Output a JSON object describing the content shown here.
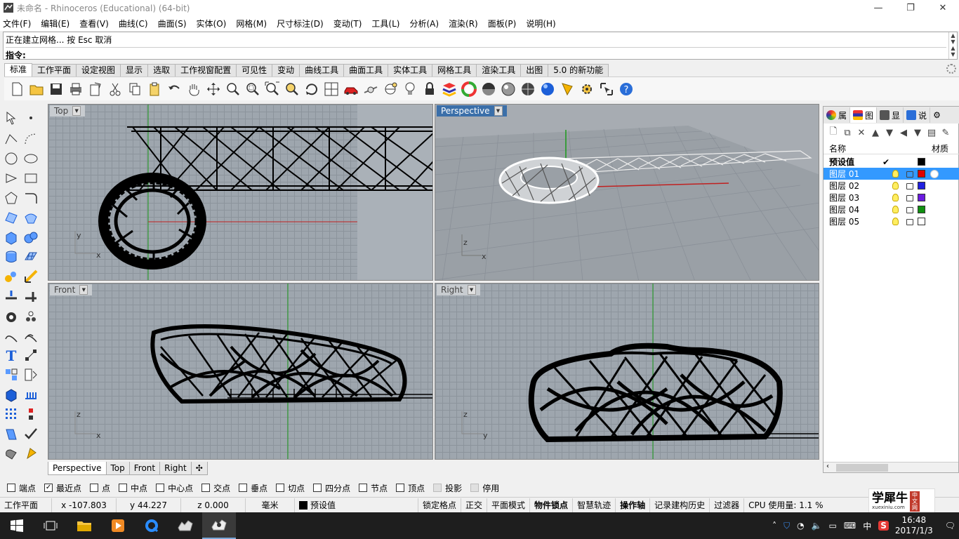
{
  "window": {
    "title": "未命名 - Rhinoceros (Educational) (64-bit)"
  },
  "menu": [
    "文件(F)",
    "编辑(E)",
    "查看(V)",
    "曲线(C)",
    "曲面(S)",
    "实体(O)",
    "网格(M)",
    "尺寸标注(D)",
    "变动(T)",
    "工具(L)",
    "分析(A)",
    "渲染(R)",
    "面板(P)",
    "说明(H)"
  ],
  "command": {
    "history": "正在建立网格... 按 Esc 取消",
    "prompt": "指令:"
  },
  "toolbar_tabs": [
    "标准",
    "工作平面",
    "设定视图",
    "显示",
    "选取",
    "工作视窗配置",
    "可见性",
    "变动",
    "曲线工具",
    "曲面工具",
    "实体工具",
    "网格工具",
    "渲染工具",
    "出图",
    "5.0 的新功能"
  ],
  "toolbar_icons": [
    "new-icon",
    "open-icon",
    "save-icon",
    "print-icon",
    "import-icon",
    "cut-icon",
    "copy-icon",
    "paste-icon",
    "undo-icon",
    "pan-hand-icon",
    "move-view-icon",
    "zoom-icon",
    "zoom-window-icon",
    "zoom-extents-icon",
    "zoom-selected-icon",
    "rotate-view-icon",
    "four-viewports-icon",
    "car-icon",
    "dimension-icon",
    "cplane-icon",
    "light-bulb-icon",
    "lock-icon",
    "layer-icon",
    "color-wheel-icon",
    "shaded-sphere-icon",
    "rendered-sphere-icon",
    "material-sphere-icon",
    "blue-sphere-icon",
    "options-icon",
    "settings-icon",
    "select-icon",
    "help-icon"
  ],
  "viewports": {
    "top": {
      "label": "Top",
      "axis_v": "y",
      "axis_h": "x"
    },
    "perspective": {
      "label": "Perspective",
      "axis_v": "z",
      "axis_h": "x"
    },
    "front": {
      "label": "Front",
      "axis_v": "z",
      "axis_h": "x"
    },
    "right": {
      "label": "Right",
      "axis_v": "z",
      "axis_h": "y"
    }
  },
  "view_tabs": [
    "Perspective",
    "Top",
    "Front",
    "Right"
  ],
  "panel": {
    "tabs": [
      "属",
      "图",
      "显",
      "说"
    ],
    "header_name": "名称",
    "header_material": "材质",
    "layers": [
      {
        "name": "预设值",
        "color": "#000000",
        "current": "✔"
      },
      {
        "name": "图层 01",
        "color": "#e00000"
      },
      {
        "name": "图层 02",
        "color": "#2020e0"
      },
      {
        "name": "图层 03",
        "color": "#6a1be0"
      },
      {
        "name": "图层 04",
        "color": "#109010"
      },
      {
        "name": "图层 05",
        "color": "#ffffff"
      }
    ]
  },
  "osnap": [
    {
      "label": "端点",
      "checked": false,
      "enabled": true
    },
    {
      "label": "最近点",
      "checked": true,
      "enabled": true
    },
    {
      "label": "点",
      "checked": false,
      "enabled": true
    },
    {
      "label": "中点",
      "checked": false,
      "enabled": true
    },
    {
      "label": "中心点",
      "checked": false,
      "enabled": true
    },
    {
      "label": "交点",
      "checked": false,
      "enabled": true
    },
    {
      "label": "垂点",
      "checked": false,
      "enabled": true
    },
    {
      "label": "切点",
      "checked": false,
      "enabled": true
    },
    {
      "label": "四分点",
      "checked": false,
      "enabled": true
    },
    {
      "label": "节点",
      "checked": false,
      "enabled": true
    },
    {
      "label": "顶点",
      "checked": false,
      "enabled": true
    },
    {
      "label": "投影",
      "checked": false,
      "enabled": false
    },
    {
      "label": "停用",
      "checked": false,
      "enabled": false
    }
  ],
  "status": {
    "cplane": "工作平面",
    "x": "x -107.803",
    "y": "y 44.227",
    "z": "z 0.000",
    "units": "毫米",
    "layer": "预设值",
    "buttons": [
      "锁定格点",
      "正交",
      "平面模式",
      "物件锁点",
      "智慧轨迹",
      "操作轴",
      "记录建构历史",
      "过滤器"
    ],
    "cpu": "CPU 使用量: 1.1 %"
  },
  "taskbar": {
    "apps": [
      "start-icon",
      "task-view-icon",
      "file-explorer-icon",
      "media-player-icon",
      "browser-icon",
      "rhino-icon",
      "rhino-active-icon"
    ],
    "ime": "中",
    "time": "16:48",
    "date": "2017/1/3"
  },
  "watermark": {
    "text": "学犀牛",
    "sub": "xuexiniu.com",
    "tag": "中文网"
  }
}
